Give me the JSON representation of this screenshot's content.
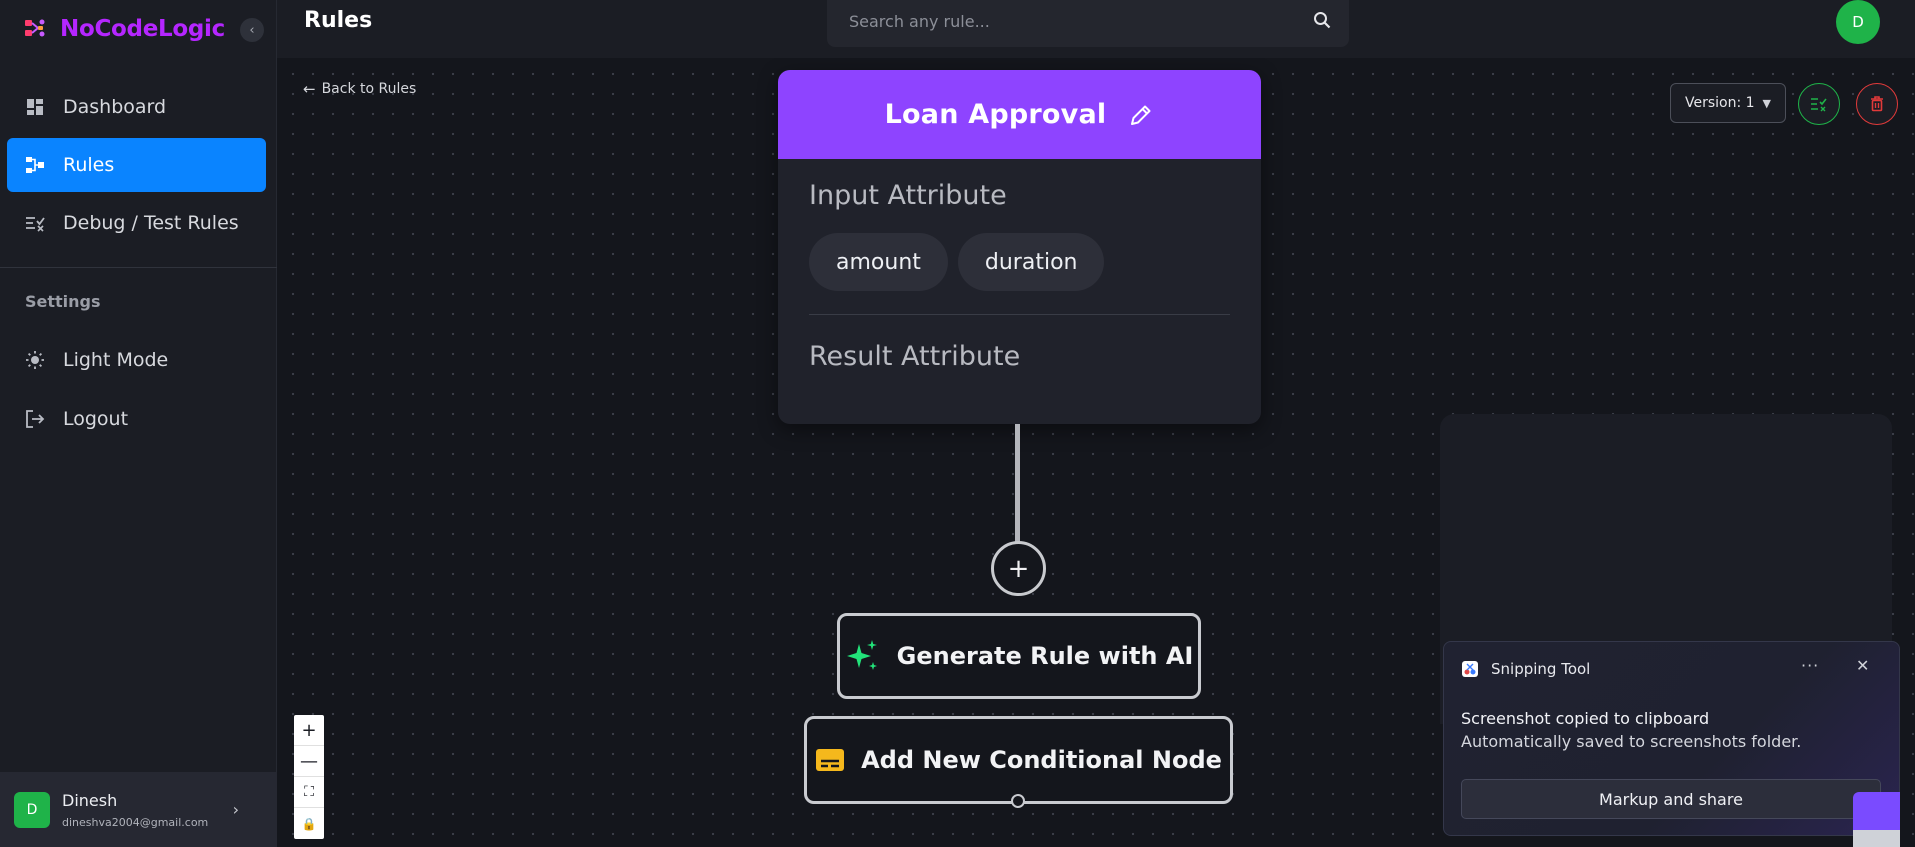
{
  "app": {
    "brand_name": "NoCodeLogic",
    "collapse_icon": "chevron-left-icon",
    "brand_color": "#b526ff",
    "accent_color": "#0a84ff"
  },
  "sidebar": {
    "items": [
      {
        "label": "Dashboard",
        "icon": "dashboard-icon",
        "active": false
      },
      {
        "label": "Rules",
        "icon": "rules-icon",
        "active": true
      },
      {
        "label": "Debug / Test Rules",
        "icon": "debug-icon",
        "active": false
      }
    ],
    "settings_label": "Settings",
    "settings_items": [
      {
        "label": "Light Mode",
        "icon": "sun-icon"
      },
      {
        "label": "Logout",
        "icon": "logout-icon"
      }
    ],
    "user": {
      "initial": "D",
      "name": "Dinesh",
      "email": "dineshva2004@gmail.com"
    }
  },
  "topbar": {
    "title": "Rules",
    "search_placeholder": "Search any rule...",
    "avatar_initial": "D"
  },
  "canvas": {
    "back_link": "Back to Rules",
    "version_label": "Version: 1",
    "rule_card": {
      "title": "Loan Approval",
      "input_attribute_title": "Input Attribute",
      "input_attributes": [
        "amount",
        "duration"
      ],
      "result_attribute_title": "Result Attribute",
      "header_color": "#8e44ff"
    },
    "add_symbol": "+",
    "generate_ai_label": "Generate Rule with AI",
    "add_node_label": "Add New Conditional Node",
    "zoom_controls": {
      "zoom_in": "+",
      "zoom_out": "—",
      "fit": "⛶",
      "lock": "🔒"
    }
  },
  "toast": {
    "app_name": "Snipping Tool",
    "more": "···",
    "close": "✕",
    "title": "Screenshot copied to clipboard",
    "body": "Automatically saved to screenshots folder.",
    "button": "Markup and share"
  }
}
